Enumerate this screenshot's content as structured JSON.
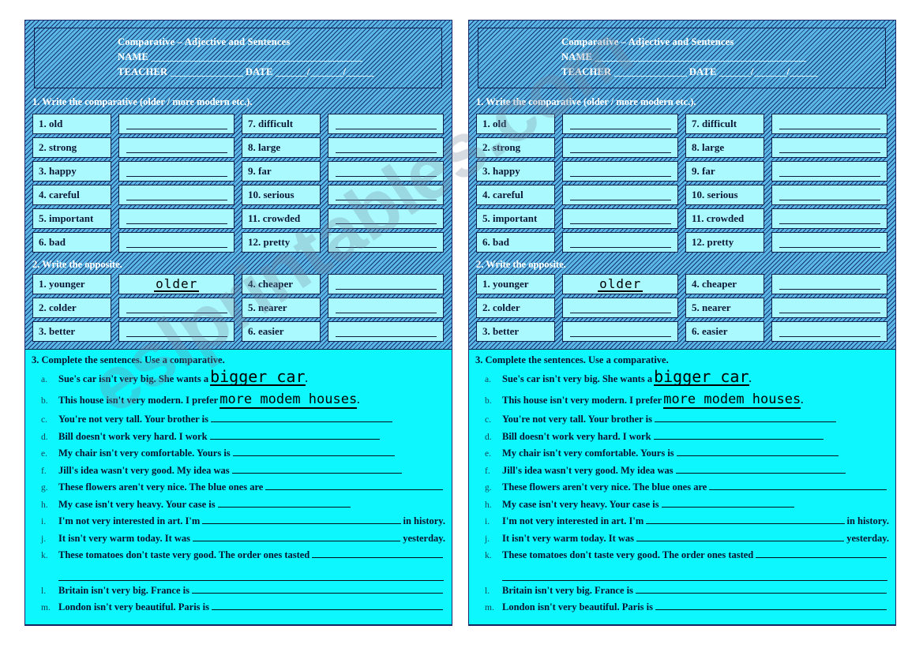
{
  "worksheet": {
    "title": "Comparative – Adjective and Sentences",
    "name_label": "NAME",
    "teacher_label": "TEACHER",
    "date_label": "DATE"
  },
  "colors": {
    "panel_hatch_blue": "#5bb8e8",
    "hatch_line": "#0a1e5a",
    "cell_fill": "#aaf9ff",
    "ex3_background": "#0df7ff",
    "border": "#10204a",
    "heading_text": "#ffffff",
    "body_text": "#07142f"
  },
  "watermark": "eslprintables.com",
  "exercise1": {
    "heading": "1. Write the comparative (older / more modern etc.).",
    "left_items": [
      "1. old",
      "2. strong",
      "3. happy",
      "4. careful",
      "5. important",
      "6. bad"
    ],
    "right_items": [
      "7. difficult",
      "8. large",
      "9. far",
      "10. serious",
      "11. crowded",
      "12. pretty"
    ],
    "left_answers": [
      "",
      "",
      "",
      "",
      "",
      ""
    ],
    "right_answers": [
      "",
      "",
      "",
      "",
      "",
      ""
    ]
  },
  "exercise2": {
    "heading": "2. Write the opposite.",
    "left_items": [
      "1. younger",
      "2. colder",
      "3. better"
    ],
    "right_items": [
      "4. cheaper",
      "5. nearer",
      "6. easier"
    ],
    "left_answers": [
      "older",
      "",
      ""
    ],
    "right_answers": [
      "",
      "",
      ""
    ]
  },
  "exercise3": {
    "heading": "3. Complete the sentences. Use a comparative.",
    "items": [
      {
        "mark": "a.",
        "before": "Sue's car isn't very big. She wants a",
        "answer": "bigger car",
        "after": "."
      },
      {
        "mark": "b.",
        "before": "This house isn't very modern. I prefer",
        "answer": "more modem houses",
        "after": "."
      },
      {
        "mark": "c.",
        "before": "You're not very tall. Your brother is",
        "answer": "",
        "after": ""
      },
      {
        "mark": "d.",
        "before": "Bill doesn't work very hard. I work",
        "answer": "",
        "after": ""
      },
      {
        "mark": "e.",
        "before": "My chair isn't very comfortable. Yours is",
        "answer": "",
        "after": ""
      },
      {
        "mark": "f.",
        "before": "Jill's idea wasn't very good. My idea was",
        "answer": "",
        "after": ""
      },
      {
        "mark": "g.",
        "before": "These flowers aren't very nice. The blue ones are",
        "answer": "",
        "after": ""
      },
      {
        "mark": "h.",
        "before": "My case isn't very heavy. Your case is",
        "answer": "",
        "after": ""
      },
      {
        "mark": "i.",
        "before": "I'm not very interested in art. I'm",
        "answer": "",
        "after": "in history."
      },
      {
        "mark": "j.",
        "before": "It isn't very warm today. It was",
        "answer": "",
        "after": "yesterday."
      },
      {
        "mark": "k.",
        "before": "These tomatoes don't taste very good. The order ones tasted",
        "answer": "",
        "after": ""
      },
      {
        "mark": "l.",
        "before": "Britain isn't very big. France is",
        "answer": "",
        "after": ""
      },
      {
        "mark": "m.",
        "before": "London isn't very beautiful. Paris is",
        "answer": "",
        "after": ""
      }
    ]
  }
}
